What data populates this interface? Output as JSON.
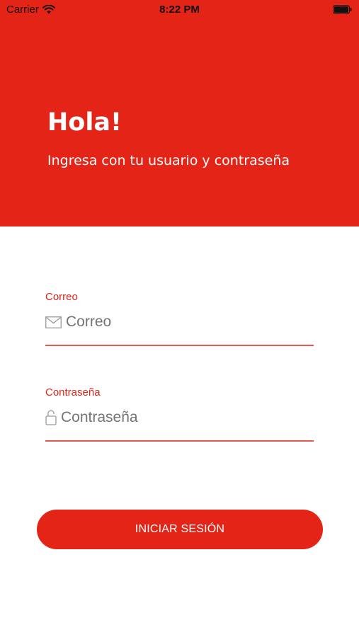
{
  "status_bar": {
    "carrier": "Carrier",
    "time": "8:22 PM",
    "icons": [
      "wifi-icon",
      "battery-icon"
    ]
  },
  "header": {
    "title": "Hola!",
    "subtitle": "Ingresa con tu usuario y contraseña",
    "background_color": "#e32417"
  },
  "form": {
    "email": {
      "label": "Correo",
      "placeholder": "Correo",
      "value": "",
      "icon": "envelope-icon"
    },
    "password": {
      "label": "Contraseña",
      "placeholder": "Contraseña",
      "value": "",
      "icon": "lock-icon"
    }
  },
  "login_button": {
    "label": "INICIAR SESIÓN"
  },
  "colors": {
    "accent": "#e32417",
    "underline": "#e85a50",
    "placeholder": "#757575"
  }
}
